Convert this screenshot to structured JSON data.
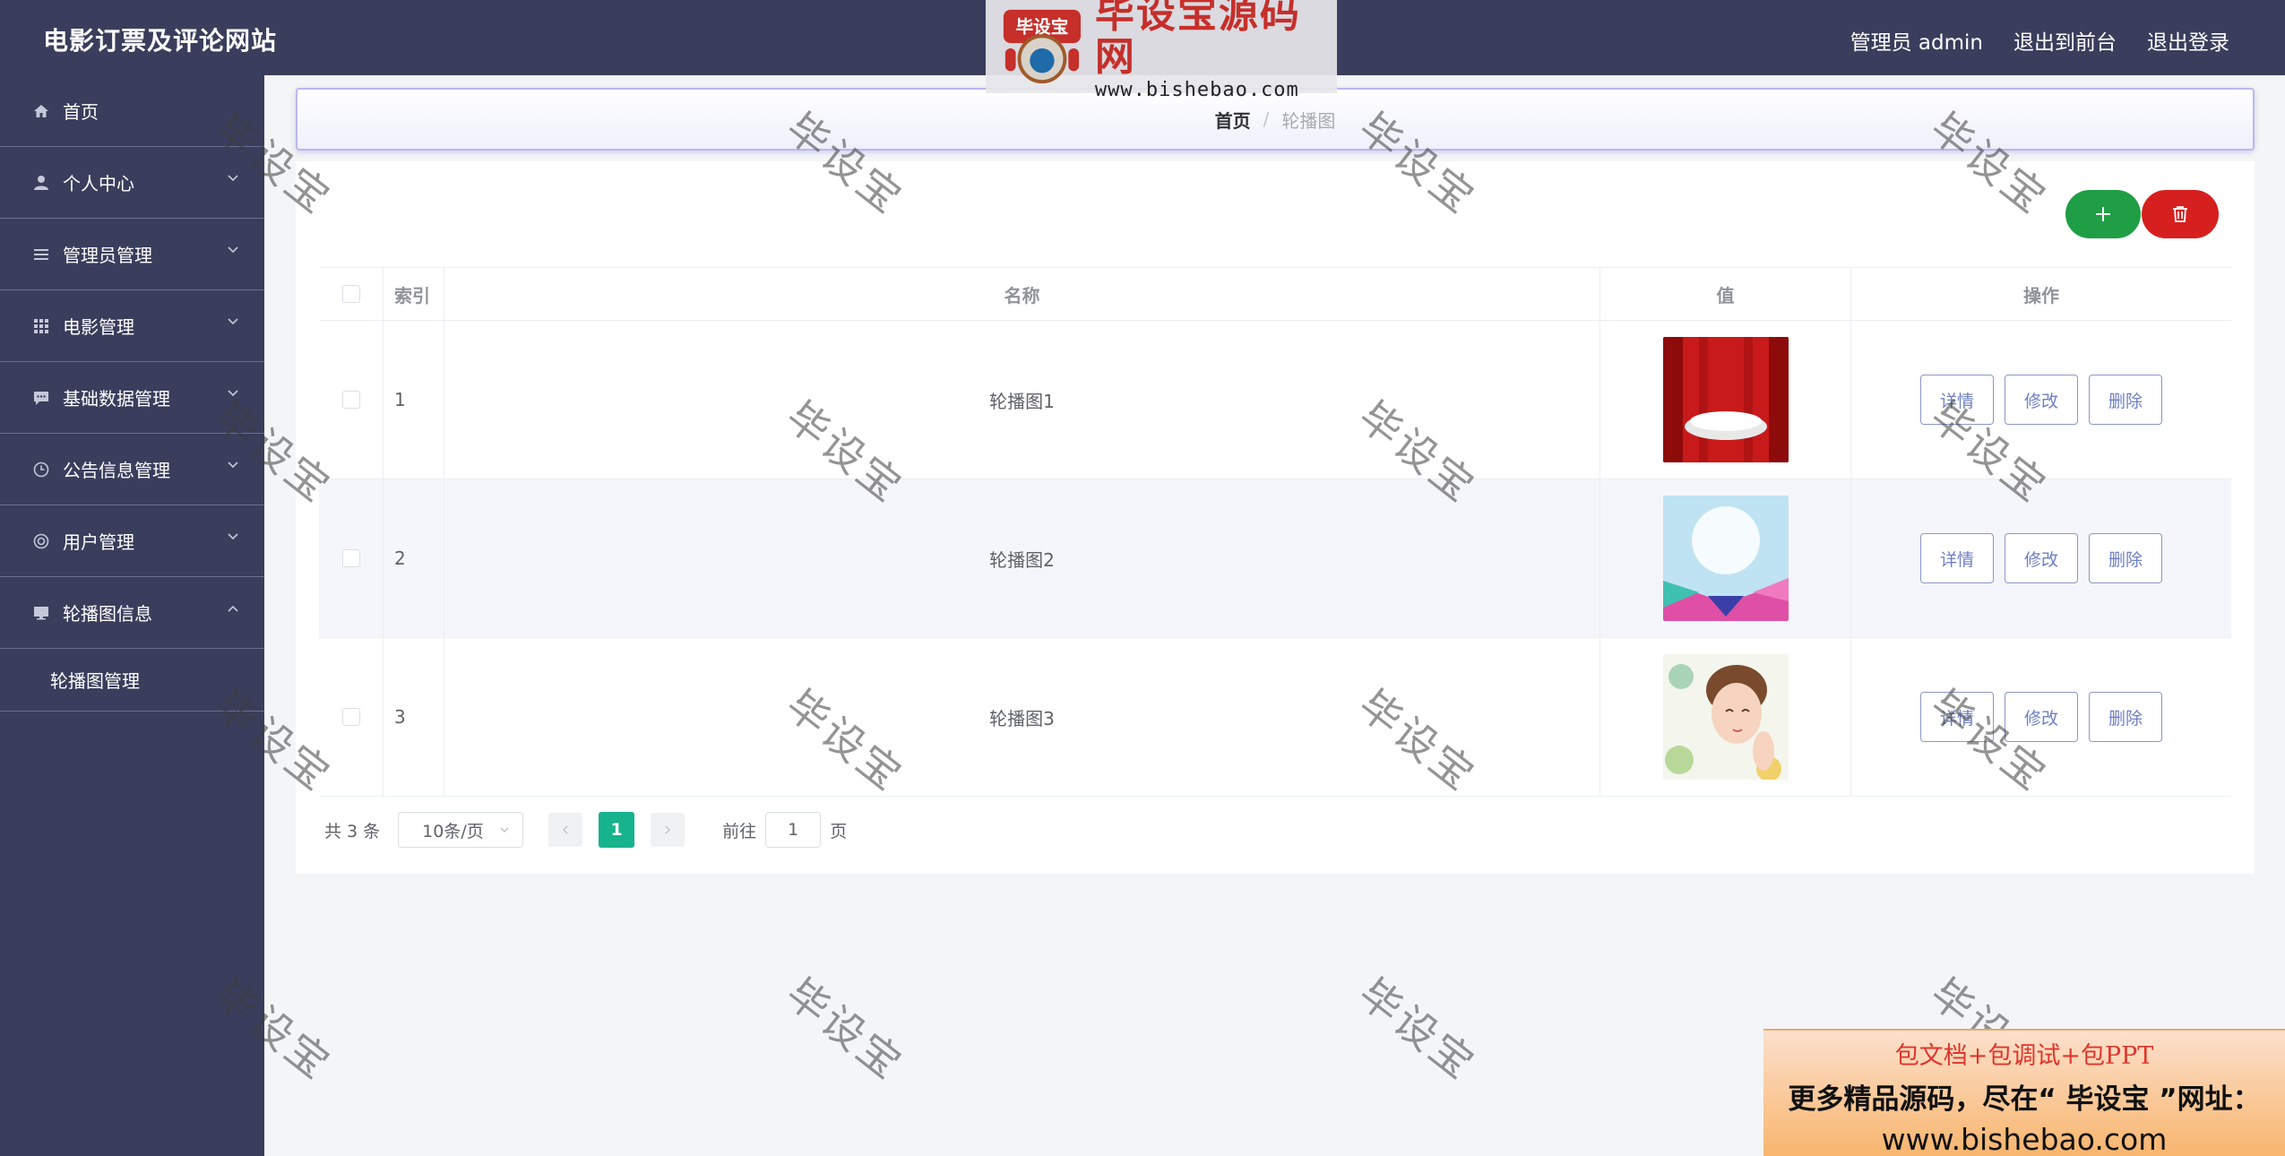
{
  "header": {
    "title": "电影订票及评论网站",
    "links": [
      "管理员 admin",
      "退出到前台",
      "退出登录"
    ]
  },
  "sidebar": {
    "items": [
      {
        "label": "首页",
        "icon": "home-icon"
      },
      {
        "label": "个人中心",
        "icon": "user-icon"
      },
      {
        "label": "管理员管理",
        "icon": "list-icon"
      },
      {
        "label": "电影管理",
        "icon": "grid-icon"
      },
      {
        "label": "基础数据管理",
        "icon": "chat-icon"
      },
      {
        "label": "公告信息管理",
        "icon": "clock-icon"
      },
      {
        "label": "用户管理",
        "icon": "lifebuoy-icon"
      },
      {
        "label": "轮播图信息",
        "icon": "monitor-icon",
        "expanded": true
      }
    ],
    "submenu": [
      {
        "label": "轮播图管理"
      }
    ]
  },
  "breadcrumb": {
    "home": "首页",
    "separator": "/",
    "current": "轮播图"
  },
  "toolbar": {
    "add_icon": "plus-icon",
    "delete_icon": "trash-icon",
    "add_color": "#1f9e45",
    "delete_color": "#d6201f"
  },
  "table": {
    "columns": [
      "索引",
      "名称",
      "值",
      "操作"
    ],
    "rows": [
      {
        "index": "1",
        "name": "轮播图1",
        "image": "red-stage-image"
      },
      {
        "index": "2",
        "name": "轮播图2",
        "image": "sky-gift-image"
      },
      {
        "index": "3",
        "name": "轮播图3",
        "image": "girl-face-image"
      }
    ],
    "actions": [
      "详情",
      "修改",
      "删除"
    ]
  },
  "pagination": {
    "total_text": "共 3 条",
    "page_size": "10条/页",
    "current_page": "1",
    "goto_label": "前往",
    "goto_value": "1",
    "page_suffix": "页",
    "accent": "#17b38c"
  },
  "logo": {
    "badge": "毕设宝",
    "title": "毕设宝源码网",
    "url": "www.bishebao.com"
  },
  "watermark": {
    "text": "毕设宝"
  },
  "promo": {
    "line1": "包文档+包调试+包PPT",
    "line2": "更多精品源码，尽在“ 毕设宝 ”网址：",
    "line3": "www.bishebao.com"
  }
}
